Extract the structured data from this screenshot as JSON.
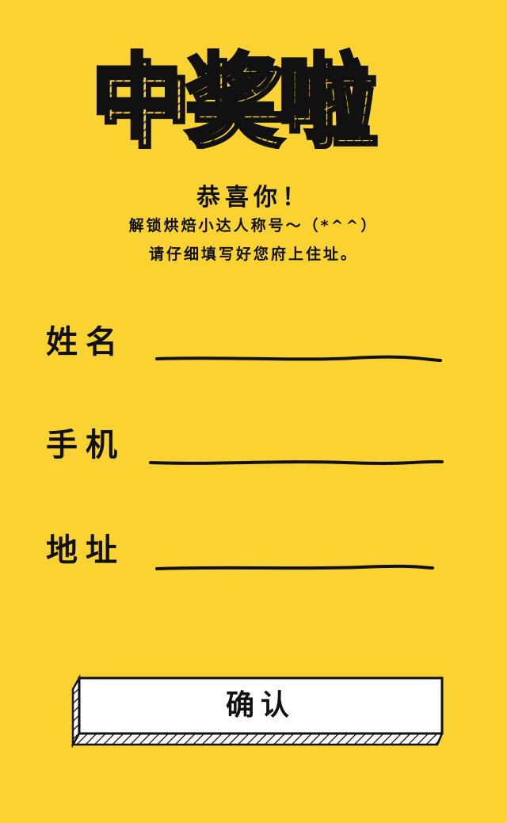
{
  "title": "中奖啦",
  "congrats": {
    "heading": "恭喜你！",
    "line1": "解锁烘焙小达人称号～（*^^）",
    "line2": "请仔细填写好您府上住址。"
  },
  "form": {
    "name_label": "姓名",
    "phone_label": "手机",
    "address_label": "地址",
    "name_value": "",
    "phone_value": "",
    "address_value": ""
  },
  "confirm_label": "确认",
  "colors": {
    "background": "#fad332",
    "ink": "#111111",
    "button_face": "#ffffff"
  }
}
